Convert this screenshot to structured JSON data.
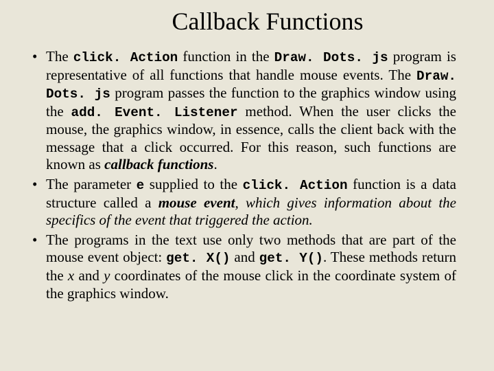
{
  "title": "Callback Functions",
  "bullets": [
    {
      "t1": "The ",
      "c1": "click. Action",
      "t2": " function in the ",
      "c2": "Draw. Dots. js",
      "t3": " program is representative of all functions that handle mouse events.  The ",
      "c3": "Draw. Dots. js",
      "t4": " program passes the function to the graphics window using the ",
      "c4": "add. Event. Listener",
      "t5": " method.  When the user clicks the mouse, the graphics window, in essence, calls the client back with the message that a click occurred.  For this reason, such functions are known as ",
      "bi1": "callback functions",
      "t6": "."
    },
    {
      "t1": "The parameter ",
      "c1": "e",
      "t2": " supplied to the ",
      "c2": "click. Action",
      "t3": " function is a data structure called a ",
      "bi1": "mouse event",
      "t4": ", which gives information about the specifics of the event that triggered the action."
    },
    {
      "t1": "The programs in the text use only two methods that are part of the mouse event object: ",
      "c1": "get. X()",
      "t2": " and ",
      "c2": "get. Y()",
      "t3": ".  These methods return the ",
      "i1": "x",
      "t4": " and ",
      "i2": "y",
      "t5": " coordinates of the mouse click in the coordinate system of the graphics window."
    }
  ]
}
